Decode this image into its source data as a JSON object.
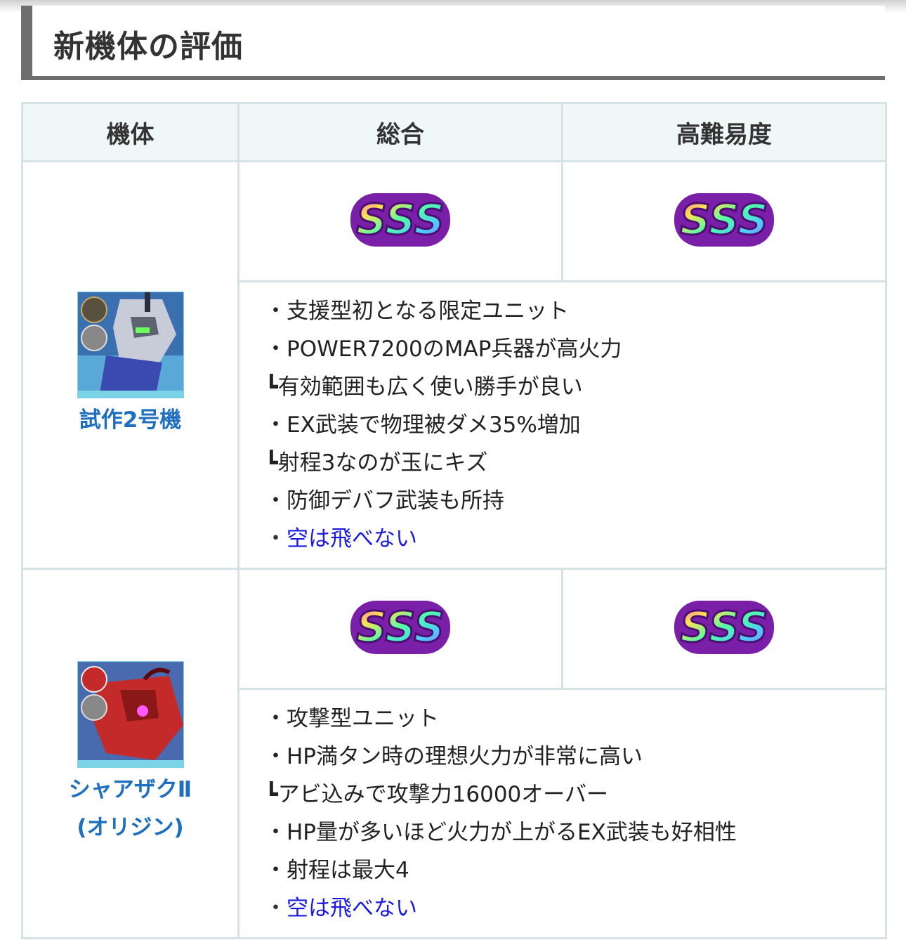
{
  "heading": "新機体の評価",
  "table": {
    "headers": [
      "機体",
      "総合",
      "高難易度"
    ],
    "rows": [
      {
        "unit_name": "試作2号機",
        "overall_rank": "SSS",
        "hard_rank": "SSS",
        "points": [
          "・支援型初となる限定ユニット",
          "・POWER7200のMAP兵器が高火力",
          "┗有効範囲も広く使い勝手が良い",
          "・EX武装で物理被ダメ35%増加",
          "┗射程3なのが玉にキズ",
          "・防御デバフ武装も所持"
        ],
        "link_dot": "・",
        "link_text": "空は飛べない"
      },
      {
        "unit_name": "シャアザクⅡ",
        "unit_name_sub": "(オリジン)",
        "overall_rank": "SSS",
        "hard_rank": "SSS",
        "points": [
          "・攻撃型ユニット",
          "・HP満タン時の理想火力が非常に高い",
          "┗アビ込みで攻撃力16000オーバー",
          "・HP量が多いほど火力が上がるEX武装も好相性",
          "・射程は最大4"
        ],
        "link_dot": "・",
        "link_text": "空は飛べない"
      }
    ]
  },
  "colors": {
    "link": "#1a1ae0",
    "unit_name": "#1e6fc0",
    "border": "#d6e3e6",
    "header_bg": "#f0f7f7"
  },
  "icons": [
    "support-type-icon",
    "terrain-ground-icon",
    "attack-type-icon",
    "sss-rank-badge"
  ]
}
